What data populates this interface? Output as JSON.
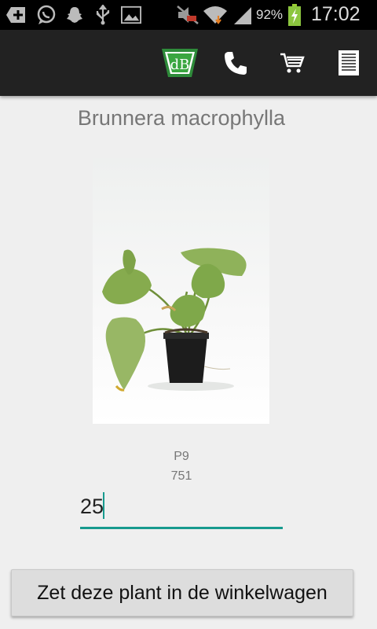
{
  "status_bar": {
    "battery_percent": "92%",
    "time": "17:02",
    "icons": [
      "plus-icon",
      "whatsapp-icon",
      "snapchat-icon",
      "usb-icon",
      "image-icon",
      "mute-icon",
      "wifi-icon",
      "signal-icon",
      "battery-charging-icon"
    ]
  },
  "action_bar": {
    "logo_text": "dB",
    "actions": [
      "logo-icon",
      "phone-icon",
      "cart-icon",
      "menu-icon"
    ]
  },
  "product": {
    "title": "Brunnera macrophylla",
    "pot_size": "P9",
    "code": "751"
  },
  "quantity": {
    "value": "25"
  },
  "add_to_cart_label": "Zet deze plant in de winkelwagen",
  "colors": {
    "accent": "#179a8e",
    "action_bar": "#222222",
    "background": "#efefef"
  }
}
